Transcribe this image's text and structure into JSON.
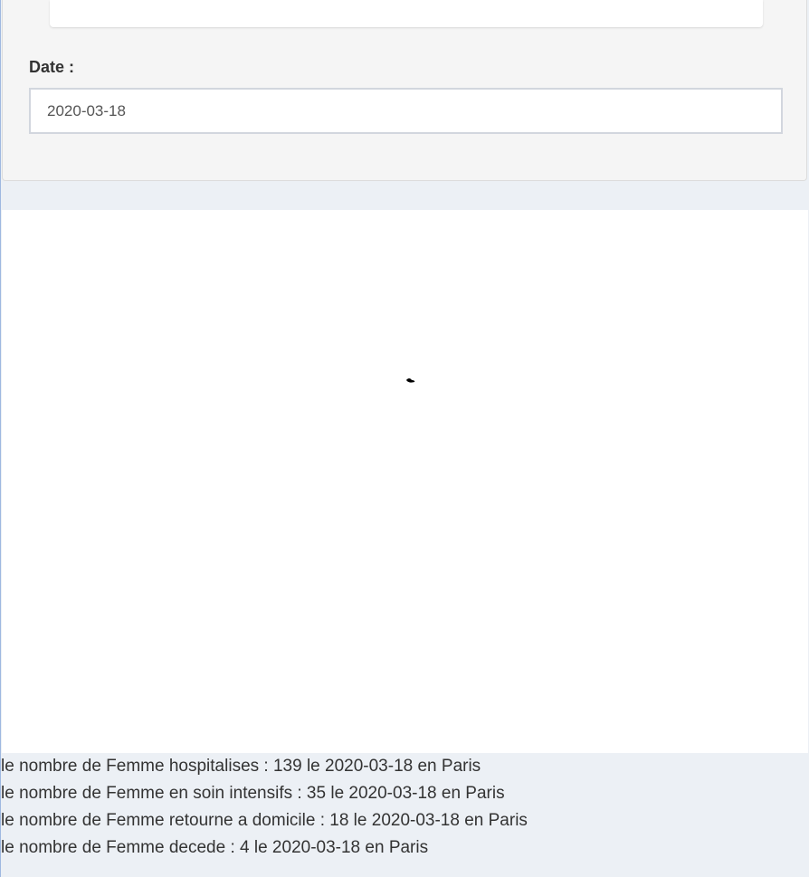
{
  "filter": {
    "date_label": "Date :",
    "date_value": "2020-03-18"
  },
  "map": {
    "shape_color": "#000000"
  },
  "stats": [
    "le nombre de Femme hospitalises : 139 le 2020-03-18 en Paris",
    "le nombre de Femme en soin intensifs : 35 le 2020-03-18 en Paris",
    "le nombre de Femme retourne a domicile : 18 le 2020-03-18 en Paris",
    "le nombre de Femme decede : 4 le 2020-03-18 en Paris"
  ]
}
